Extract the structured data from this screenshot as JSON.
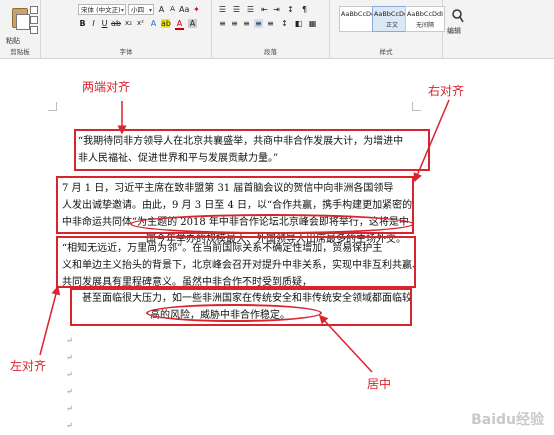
{
  "ribbon": {
    "clipboard": {
      "paste_label": "粘贴",
      "group_label": "剪贴板"
    },
    "font": {
      "font_name": "宋体 (中文正)",
      "font_size": "小四",
      "group_label": "字体"
    },
    "paragraph": {
      "group_label": "段落"
    },
    "styles": {
      "group_label": "样式",
      "items": [
        {
          "sample": "AaBbCcDdI",
          "name": ""
        },
        {
          "sample": "AaBbCcDdI",
          "name": "正文"
        },
        {
          "sample": "AaBbCcDdI",
          "name": "无间隔"
        }
      ]
    },
    "editing": {
      "label": "编辑"
    }
  },
  "document": {
    "paragraphs": [
      {
        "lines": [
          "“我期待同非方领导人在北京共襄盛举，共商中非合作发展大计，为增进中",
          "非人民福祉、促进世界和平与发展贡献力量。”"
        ]
      },
      {
        "lines": [
          "7 月 1 日，习近平主席在致非盟第 31 届首脑会议的贺信中向非洲各国领导",
          "人发出诚挚邀请。由此，9 月 3 日至 4 日，以“合作共赢，携手构建更加紧密的",
          "中非命运共同体”为主题的 2018 年中非合作论坛北京峰会即将举行，这将是中",
          "国今年举办的规模最大、外国领导人出席最多的主场外交。"
        ]
      },
      {
        "lines": [
          "“相知无远近，万里尚为邻”。在当前国际关系不确定性增加，贸易保护主",
          "义和单边主义抬头的背景下，北京峰会召开对提升中非关系，实现中非互利共赢、",
          "共同发展具有里程碑意义。虽然中非合作不时受到质疑，"
        ]
      },
      {
        "lines": [
          "甚至面临很大压力，如一些非洲国家在传统安全和非传统安全领域都面临较",
          "高的风险，威胁中非合作稳定。"
        ]
      }
    ],
    "return_mark": "↵"
  },
  "annotations": {
    "justify": "两端对齐",
    "right": "右对齐",
    "left": "左对齐",
    "center": "居中"
  },
  "watermark": "Baidu经验",
  "colors": {
    "annotation": "#d9232d"
  }
}
